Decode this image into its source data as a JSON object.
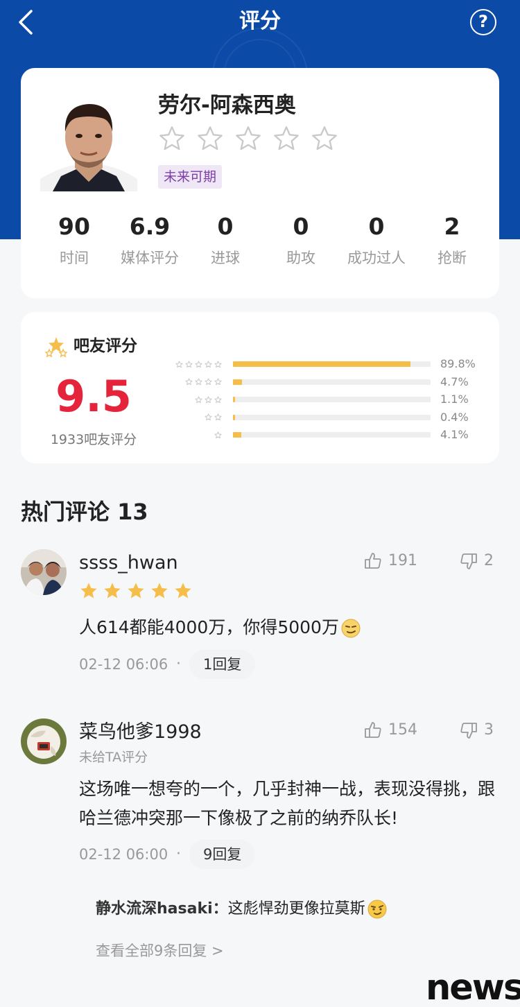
{
  "header": {
    "title": "评分"
  },
  "player": {
    "name": "劳尔-阿森西奥",
    "tag": "未来可期",
    "stats": [
      {
        "value": "90",
        "label": "时间"
      },
      {
        "value": "6.9",
        "label": "媒体评分"
      },
      {
        "value": "0",
        "label": "进球"
      },
      {
        "value": "0",
        "label": "助攻"
      },
      {
        "value": "0",
        "label": "成功过人"
      },
      {
        "value": "2",
        "label": "抢断"
      }
    ]
  },
  "fan_rating": {
    "title": "吧友评分",
    "score": "9.5",
    "count_label": "1933吧友评分",
    "distribution": [
      {
        "stars": 5,
        "percent": 89.8,
        "label": "89.8%"
      },
      {
        "stars": 4,
        "percent": 4.7,
        "label": "4.7%"
      },
      {
        "stars": 3,
        "percent": 1.1,
        "label": "1.1%"
      },
      {
        "stars": 2,
        "percent": 0.4,
        "label": "0.4%"
      },
      {
        "stars": 1,
        "percent": 4.1,
        "label": "4.1%"
      }
    ]
  },
  "comments_section": {
    "title": "热门评论 13"
  },
  "comments": [
    {
      "user": "ssss_hwan",
      "likes": "191",
      "dislikes": "2",
      "rating_stars": 5,
      "text": "人614都能4000万，你得5000万",
      "time": "02-12 06:06",
      "reply_count": "1回复"
    },
    {
      "user": "菜鸟他爹1998",
      "likes": "154",
      "dislikes": "3",
      "sub": "未给TA评分",
      "text": "这场唯一想夸的一个，几乎封神一战，表现没得挑，跟哈兰德冲突那一下像极了之前的纳乔队长!",
      "time": "02-12 06:00",
      "reply_count": "9回复",
      "reply_preview": {
        "user": "静水流深hasaki：",
        "text": "这彪悍劲更像拉莫斯"
      },
      "view_all": "查看全部9条回复 >"
    }
  ],
  "watermark": "news",
  "colors": {
    "header_blue": "#0b4aa6",
    "score_red": "#e5233b",
    "star_gold": "#f5bd4a",
    "tag_purple": "#7b3fa6"
  }
}
